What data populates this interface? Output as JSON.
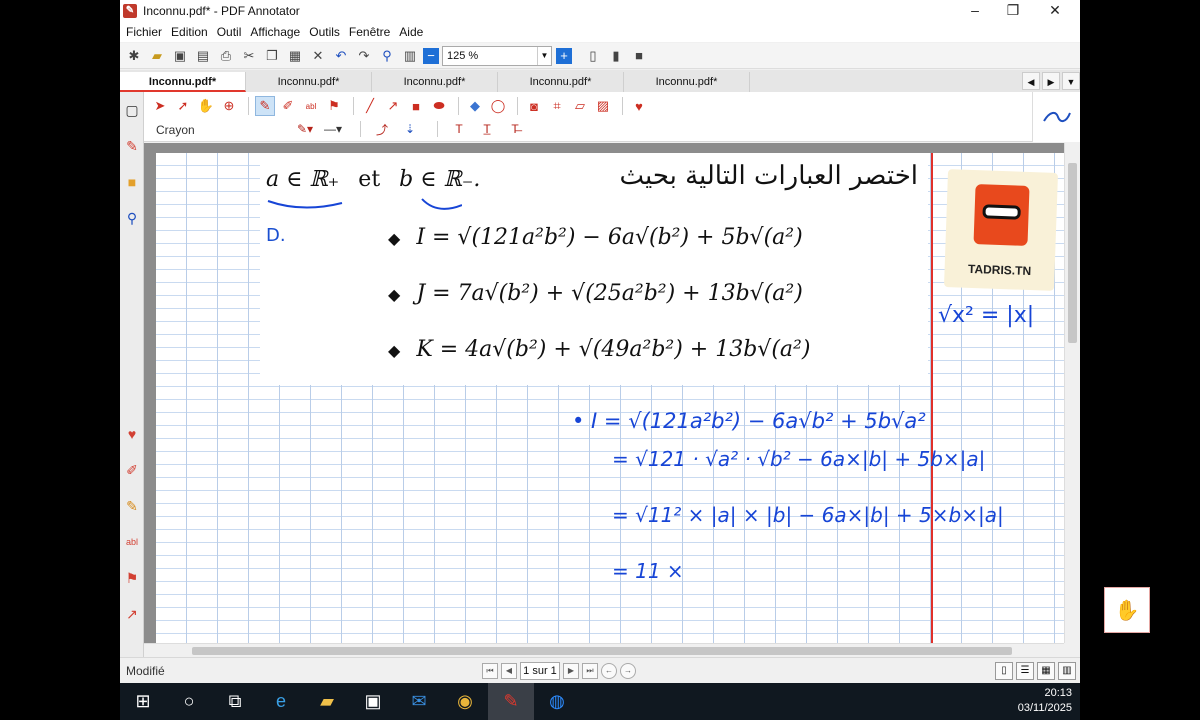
{
  "window": {
    "title": "Inconnu.pdf* - PDF Annotator",
    "app_icon": "pdf-annotator-logo",
    "controls": [
      "minimize",
      "restore",
      "close"
    ]
  },
  "menu": {
    "items": [
      "Fichier",
      "Edition",
      "Outil",
      "Affichage",
      "Outils",
      "Fenêtre",
      "Aide"
    ]
  },
  "toolbar": {
    "zoom": "125 %",
    "icons": [
      "new-icon",
      "open-icon",
      "save-icon",
      "save-as-icon",
      "print-icon",
      "cut-icon",
      "copy-icon",
      "paste-icon",
      "delete-icon",
      "undo-icon",
      "redo-icon",
      "binoculars-icon",
      "grid-icon",
      "zoom-out-icon",
      "zoom-in-icon",
      "page-view-icon",
      "two-page-icon",
      "full-page-icon"
    ]
  },
  "tabs": [
    {
      "label": "Inconnu.pdf*",
      "active": true
    },
    {
      "label": "Inconnu.pdf*",
      "active": false
    },
    {
      "label": "Inconnu.pdf*",
      "active": false
    },
    {
      "label": "Inconnu.pdf*",
      "active": false
    },
    {
      "label": "Inconnu.pdf*",
      "active": false
    }
  ],
  "annotation_toolbar": {
    "tool_name": "Crayon",
    "active_tool": "pen-tool"
  },
  "document": {
    "arabic_heading": "اختصر العبارات التالية بحيث",
    "condition": {
      "a_part": "a ∈ ℝ₊",
      "et": "et",
      "b_part": "b ∈ ℝ₋."
    },
    "handwritten_label": "D.",
    "formulas": [
      "I = √(121a²b²) − 6a√(b²) + 5b√(a²)",
      "J = 7a√(b²) + √(25a²b²) + 13b√(a²)",
      "K = 4a√(b²) + √(49a²b²) + 13b√(a²)"
    ],
    "logo_text": "TADRIS.TN",
    "handwriting": {
      "note": "√x² = |x|",
      "lines": [
        "• I = √(121a²b²) − 6a√b² + 5b√a²",
        "= √121 · √a² · √b² − 6a×|b| + 5b×|a|",
        "= √11² × |a| × |b| − 6a×|b| + 5×b×|a|",
        "= 11 ×"
      ]
    }
  },
  "status": {
    "text": "Modifié",
    "page_info": "1 sur 1"
  },
  "taskbar": {
    "time": "20:13",
    "date": "03/11/2025"
  },
  "colors": {
    "accent": "#e1382d",
    "ink": "#1745d6",
    "margin_line": "#e0302a"
  }
}
